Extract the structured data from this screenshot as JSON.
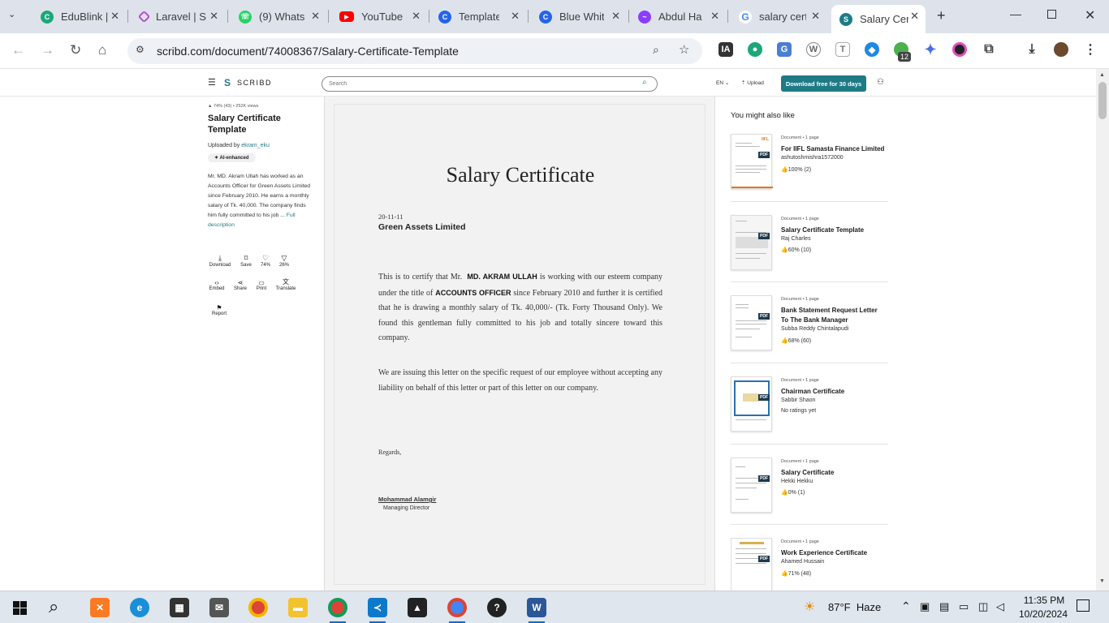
{
  "browser": {
    "tabs": [
      {
        "label": "EduBlink |",
        "favicon_color": "#1aa87a"
      },
      {
        "label": "Laravel | S",
        "favicon_color": "#b84cd6"
      },
      {
        "label": "(9) Whats",
        "favicon_color": "#25d366"
      },
      {
        "label": "YouTube",
        "favicon_color": "#ff0000"
      },
      {
        "label": "Templates",
        "favicon_color": "#2563eb"
      },
      {
        "label": "Blue Whit",
        "favicon_color": "#2563eb"
      },
      {
        "label": "Abdul Ha",
        "favicon_color": "#8b3dff"
      },
      {
        "label": "salary cert",
        "favicon_color": "#4285f4"
      },
      {
        "label": "Salary Cer",
        "favicon_color": "#1e7b85",
        "active": true
      }
    ],
    "url": "scribd.com/document/74008367/Salary-Certificate-Template",
    "ext_badge": "12"
  },
  "scribd": {
    "logo": "SCRIBD",
    "search_placeholder": "Search",
    "lang": "EN",
    "upload": "Upload",
    "download_cta": "Download free for 30 days"
  },
  "sidebar": {
    "stats": "74% (43) • 252K views",
    "title": "Salary Certificate Template",
    "uploaded_by_label": "Uploaded by",
    "uploader": "ekram_eku",
    "ai_badge": "AI-enhanced",
    "description": "Mr. MD. Akram Ullah has worked as an Accounts Officer for Green Assets Limited since February 2010. He earns a monthly salary of Tk. 40,000. The company finds him fully committed to his job ...",
    "full_description": "Full description",
    "actions": [
      "Download",
      "Save",
      "74%",
      "26%",
      "Embed",
      "Share",
      "Print",
      "Translate",
      "Report"
    ]
  },
  "document": {
    "heading": "Salary Certificate",
    "date": "20-11-11",
    "company": "Green Assets Limited",
    "para1_a": "This is to certify that Mr.",
    "para1_name": "MD. AKRAM ULLAH",
    "para1_b": "is working with our esteem company under the title of",
    "para1_title": "ACCOUNTS OFFICER",
    "para1_c": "since February 2010 and further it is certified that he is drawing a monthly salary of Tk. 40,000/- (Tk. Forty Thousand Only). We found this gentleman fully committed to his job and totally sincere toward this company.",
    "para2": "We are issuing this letter on the specific request of our employee without accepting any liability on behalf of this letter or part of this letter on our company.",
    "regards": "Regards,",
    "signer": "Mohammad Alamgir",
    "signer_title": "Managing Director"
  },
  "related": {
    "heading": "You might also like",
    "items": [
      {
        "meta": "Document • 1 page",
        "title": "For IIFL Samasta Finance Limited",
        "author": "ashutoshmishra1572000",
        "rating": "👍100% (2)"
      },
      {
        "meta": "Document • 1 page",
        "title": "Salary Certificate Template",
        "author": "Raj Charles",
        "rating": "👍60% (10)"
      },
      {
        "meta": "Document • 1 page",
        "title": "Bank Statement Request Letter To The Bank Manager",
        "author": "Subba Reddy Chintalapudi",
        "rating": "👍68% (60)"
      },
      {
        "meta": "Document • 1 page",
        "title": "Chairman Certificate",
        "author": "Sabbir Shaon",
        "rating": "No ratings yet"
      },
      {
        "meta": "Document • 1 page",
        "title": "Salary Certificate",
        "author": "Hekki Hekku",
        "rating": "👍0% (1)"
      },
      {
        "meta": "Document • 1 page",
        "title": "Work Experience Certificate",
        "author": "Ahamed Hussain",
        "rating": "👍71% (48)"
      }
    ],
    "pdf_label": "PDF"
  },
  "taskbar": {
    "weather": "87°F  Haze",
    "time": "11:35 PM",
    "date": "10/20/2024"
  }
}
